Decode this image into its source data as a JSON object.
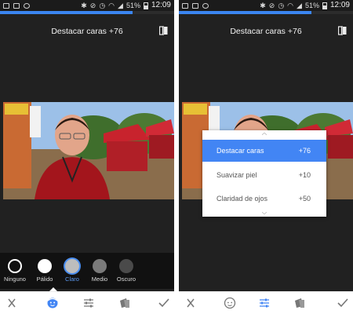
{
  "status_bar": {
    "battery": "51%",
    "clock": "12:09"
  },
  "screens": [
    {
      "title": "Destacar caras +76",
      "progress_fraction": 0.76,
      "presets": [
        {
          "label": "Ninguno",
          "color": "#111111",
          "selected": false
        },
        {
          "label": "Pálido",
          "color": "#ffffff",
          "selected": false
        },
        {
          "label": "Claro",
          "color": "#bdbdbd",
          "selected": true
        },
        {
          "label": "Medio",
          "color": "#7a7a7a",
          "selected": false
        },
        {
          "label": "Oscuro",
          "color": "#4a4a4a",
          "selected": false
        }
      ],
      "active_tool": "face-icon"
    },
    {
      "title": "Destacar caras +76",
      "progress_fraction": 0.76,
      "menu": [
        {
          "label": "Destacar caras",
          "value": "+76",
          "active": true
        },
        {
          "label": "Suavizar piel",
          "value": "+10",
          "active": false
        },
        {
          "label": "Claridad de ojos",
          "value": "+50",
          "active": false
        }
      ],
      "active_tool": "sliders-icon"
    }
  ],
  "navbar_icons": [
    "close-icon",
    "face-icon",
    "sliders-icon",
    "styles-icon",
    "check-icon"
  ],
  "colors": {
    "accent": "#4285f4",
    "editor_background": "#212121",
    "tool_bar": "#111111"
  }
}
